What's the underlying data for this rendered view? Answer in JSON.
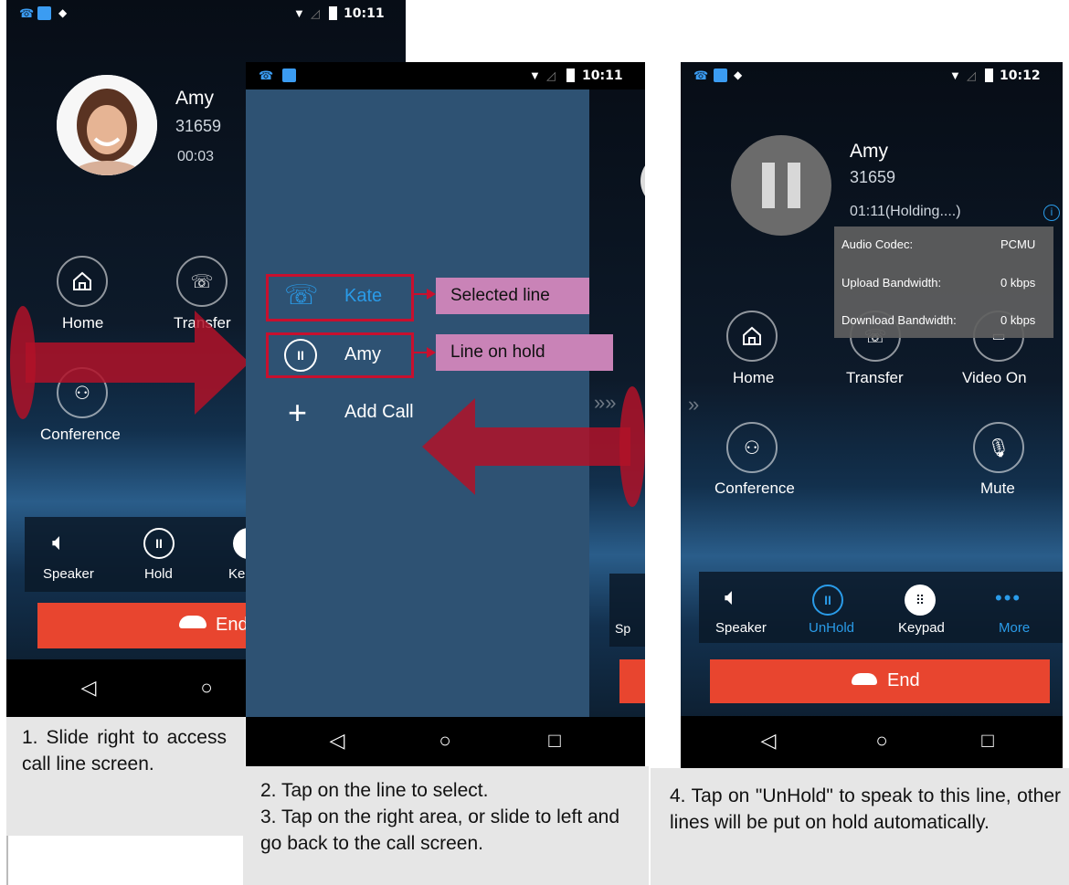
{
  "colors": {
    "accent_blue": "#2a9be8",
    "end_red": "#e8452f",
    "drawer_bg": "#2e5273",
    "tag_pink": "#c983b7",
    "arrow_red": "#b01228"
  },
  "status": {
    "time1": "10:11",
    "time2": "10:11",
    "time3": "10:12"
  },
  "panel1": {
    "contact_name": "Amy",
    "contact_number": "31659",
    "call_timer": "00:03",
    "buttons": {
      "home": "Home",
      "transfer": "Transfer",
      "conference": "Conference"
    },
    "bottom": {
      "speaker": "Speaker",
      "hold": "Hold",
      "keypad": "Ke"
    },
    "end": "End",
    "caption": "1. Slide right to access call line screen."
  },
  "panel2": {
    "lines": [
      {
        "label": "Kate"
      },
      {
        "label": "Amy"
      }
    ],
    "add_call": "Add Call",
    "tag_selected": "Selected line",
    "tag_hold": "Line on hold",
    "bottom_partial": "Sp",
    "caption_line1": "2. Tap on the line to select.",
    "caption_line2": "3. Tap on the right area, or slide to left and go back to the call screen."
  },
  "panel3": {
    "contact_name": "Amy",
    "contact_number": "31659",
    "call_status": "01:11(Holding....)",
    "info": [
      {
        "label": "Audio Codec:",
        "value": "PCMU"
      },
      {
        "label": "Upload Bandwidth:",
        "value": "0 kbps"
      },
      {
        "label": "Download Bandwidth:",
        "value": "0 kbps"
      }
    ],
    "buttons": {
      "home": "Home",
      "transfer": "Transfer",
      "video": "Video On",
      "conference": "Conference",
      "mute": "Mute"
    },
    "bottom": {
      "speaker": "Speaker",
      "unhold": "UnHold",
      "keypad": "Keypad",
      "more": "More"
    },
    "end": "End",
    "caption": "4. Tap on \"UnHold\" to speak to this line, other lines will be put on hold automatically."
  },
  "icons": [
    "home-icon",
    "transfer-icon",
    "conference-icon",
    "speaker-icon",
    "hold-icon",
    "keypad-icon",
    "more-icon",
    "mute-icon",
    "video-icon",
    "end-call-icon",
    "back-icon",
    "home-nav-icon",
    "recent-apps-icon",
    "info-icon",
    "pause-icon",
    "add-icon",
    "wifi-icon",
    "signal-icon",
    "battery-icon"
  ]
}
